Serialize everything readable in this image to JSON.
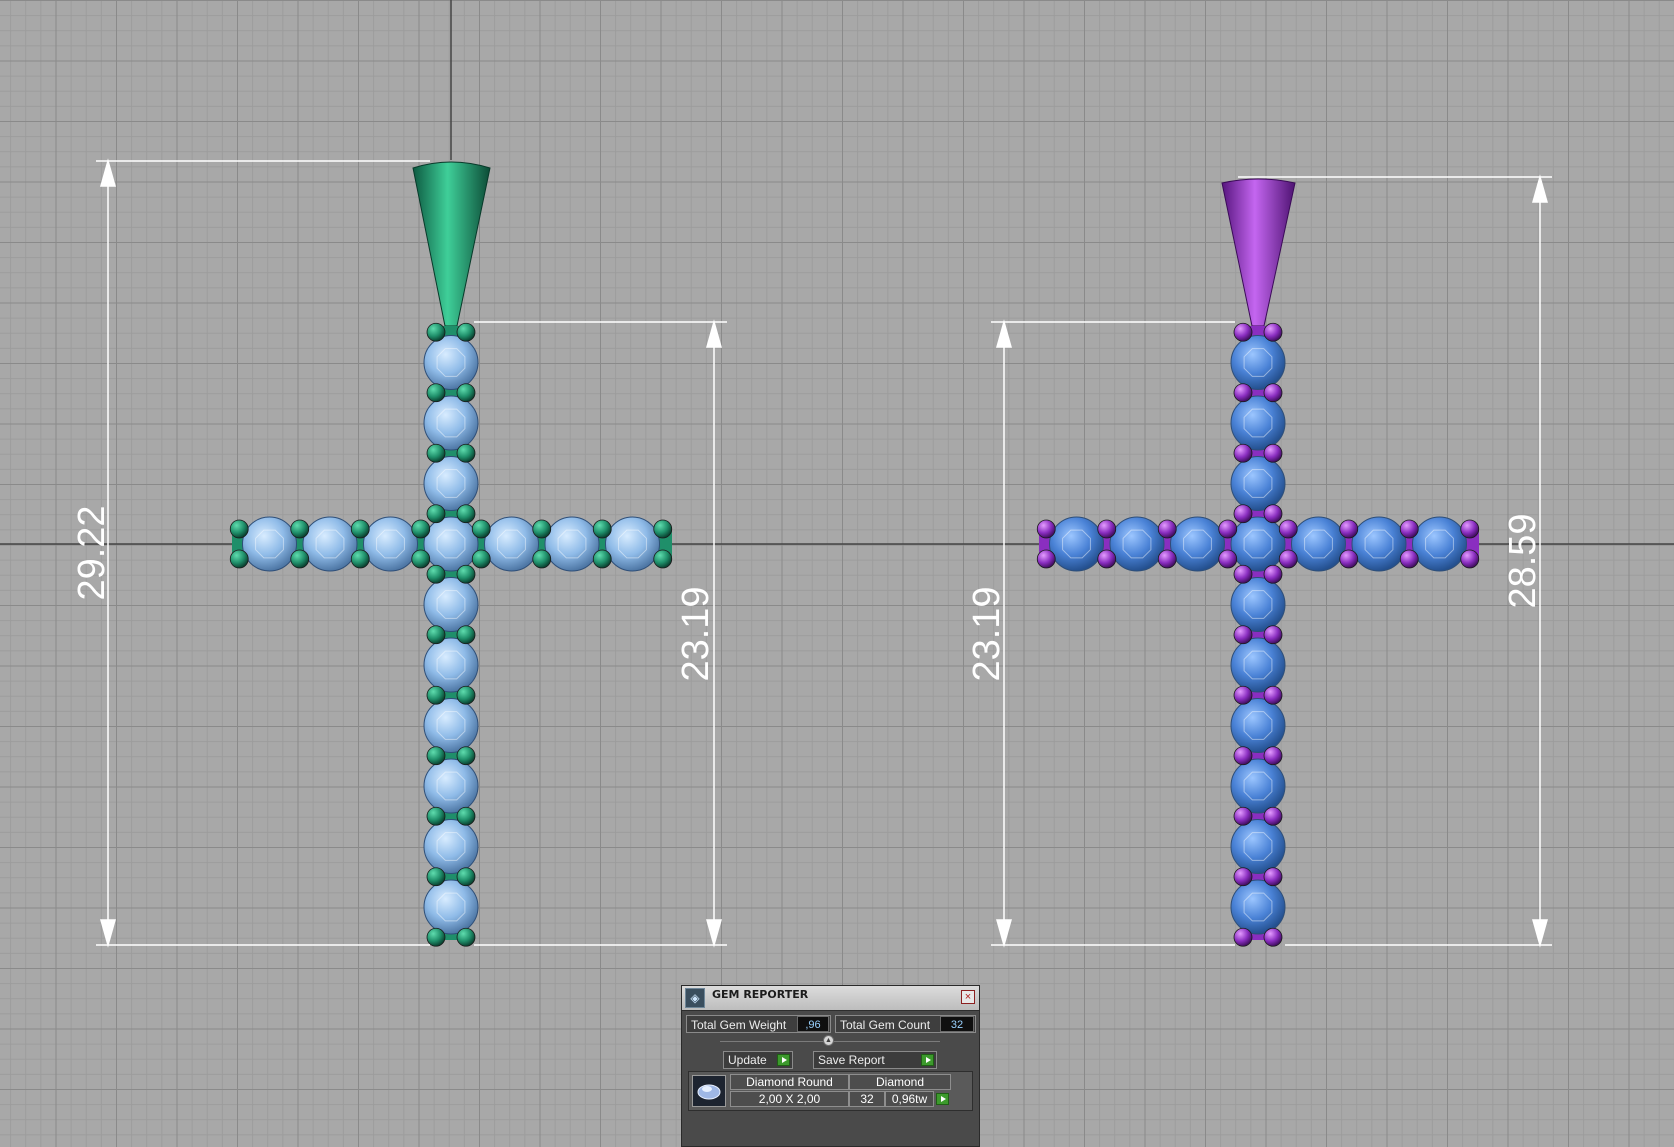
{
  "dimensions": {
    "left_total": "29.22",
    "left_inner": "23.19",
    "right_inner": "23.19",
    "right_total": "28.59"
  },
  "colors": {
    "grid_bg": "#a8a8a8",
    "green_metal": "#1f8f6a",
    "purple_metal": "#8a2ec0",
    "light_gem": "#8fbbe8",
    "dark_gem": "#4a82d6",
    "dimension_line": "#ffffff"
  },
  "gem_reporter": {
    "title": "GEM REPORTER",
    "title_icon": "gem-reporter-icon",
    "close_glyph": "×",
    "total_weight_label": "Total Gem Weight",
    "total_weight_value": ",96",
    "total_count_label": "Total Gem Count",
    "total_count_value": "32",
    "divider_glyph": "▲",
    "update_label": "Update",
    "save_report_label": "Save Report",
    "row": {
      "shape": "Diamond Round",
      "size": "2,00 X 2,00",
      "material": "Diamond",
      "count": "32",
      "weight": "0,96tw"
    }
  }
}
